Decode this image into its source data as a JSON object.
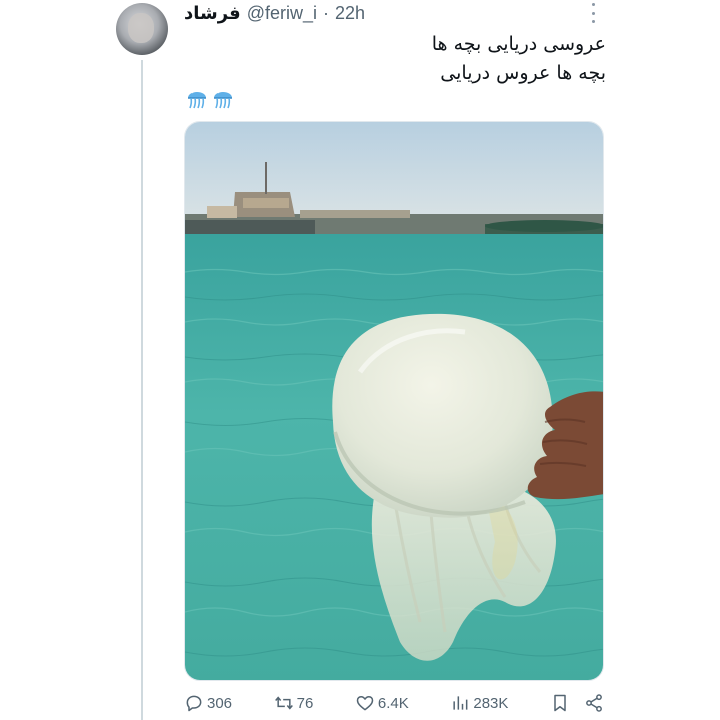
{
  "tweet": {
    "author_name": "فرشاد",
    "handle": "@feriw_i",
    "separator": "·",
    "time": "22h",
    "text_lines": [
      "عروسی دریایی بچه ها",
      "بچه ها عروس دریایی"
    ],
    "emojis": [
      "jellyfish-icon",
      "jellyfish-icon"
    ]
  },
  "actions": {
    "replies": "306",
    "retweets": "76",
    "likes": "6.4K",
    "views": "283K"
  },
  "colors": {
    "text_primary": "#0f1419",
    "text_secondary": "#536471",
    "thread_line": "#cfd9de",
    "sea": "#4fb3aa",
    "sky": "#c9dbe6"
  }
}
